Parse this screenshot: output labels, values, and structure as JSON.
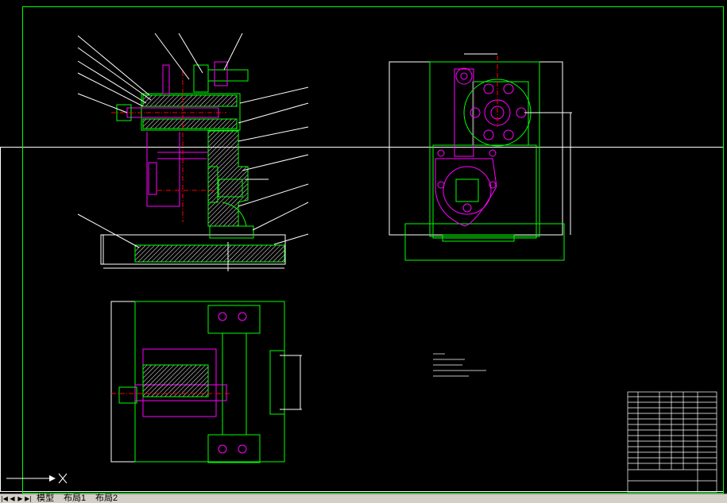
{
  "tabs": [
    {
      "label": "模型"
    },
    {
      "label": "布局1"
    },
    {
      "label": "布局2"
    }
  ],
  "tab_nav": [
    "|◀",
    "◀",
    "▶",
    "▶|"
  ],
  "colors": {
    "background": "#000000",
    "frame": "#00ff00",
    "outline": "#00ff00",
    "part": "#ff00ff",
    "hatch": "#ffffff",
    "center_line": "#ff0000",
    "dimension": "#ffffff",
    "leader": "#ffffff"
  },
  "icons": {
    "ucs": "ucs-axis-icon"
  }
}
